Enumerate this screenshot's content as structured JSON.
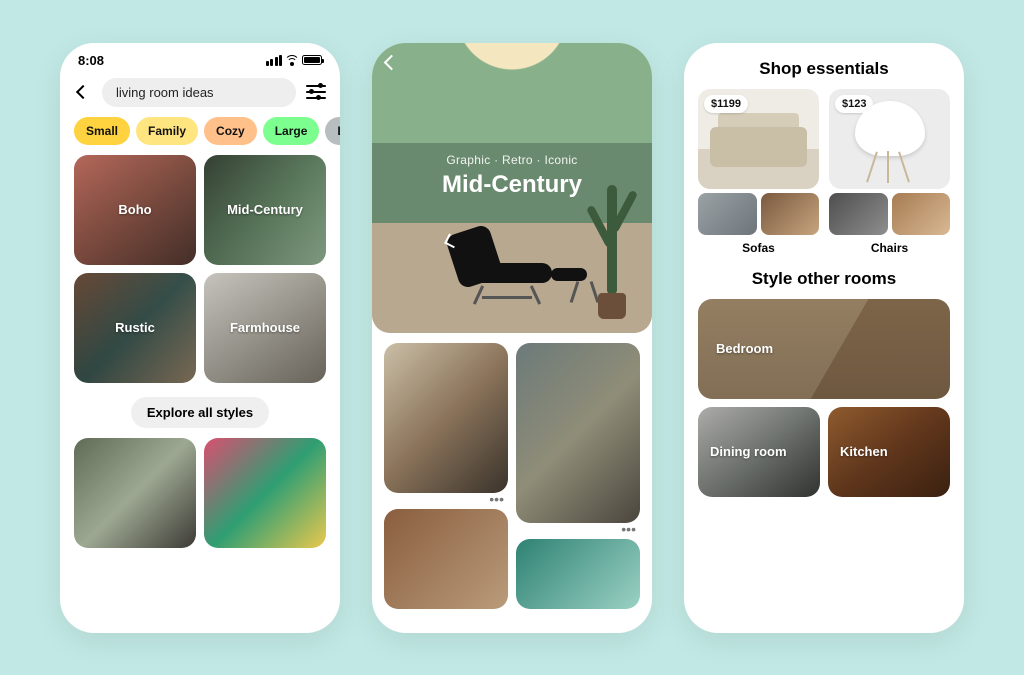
{
  "status": {
    "time": "8:08"
  },
  "search": {
    "query": "living room ideas"
  },
  "chips": [
    {
      "label": "Small",
      "bg": "#ffd23f"
    },
    {
      "label": "Family",
      "bg": "#ffe57f"
    },
    {
      "label": "Cozy",
      "bg": "#ffc08a"
    },
    {
      "label": "Large",
      "bg": "#7dff8f"
    },
    {
      "label": "Layout",
      "bg": "#b8bdbf"
    }
  ],
  "styles": {
    "tiles": [
      "Boho",
      "Mid-Century",
      "Rustic",
      "Farmhouse"
    ],
    "cta": "Explore all styles"
  },
  "hero": {
    "tagline": "Graphic · Retro · Iconic",
    "title": "Mid-Century"
  },
  "shop": {
    "heading": "Shop essentials",
    "products": [
      {
        "price": "$1199",
        "label": "Sofas"
      },
      {
        "price": "$123",
        "label": "Chairs"
      }
    ]
  },
  "rooms": {
    "heading": "Style other rooms",
    "items": [
      "Bedroom",
      "Dining room",
      "Kitchen"
    ]
  }
}
